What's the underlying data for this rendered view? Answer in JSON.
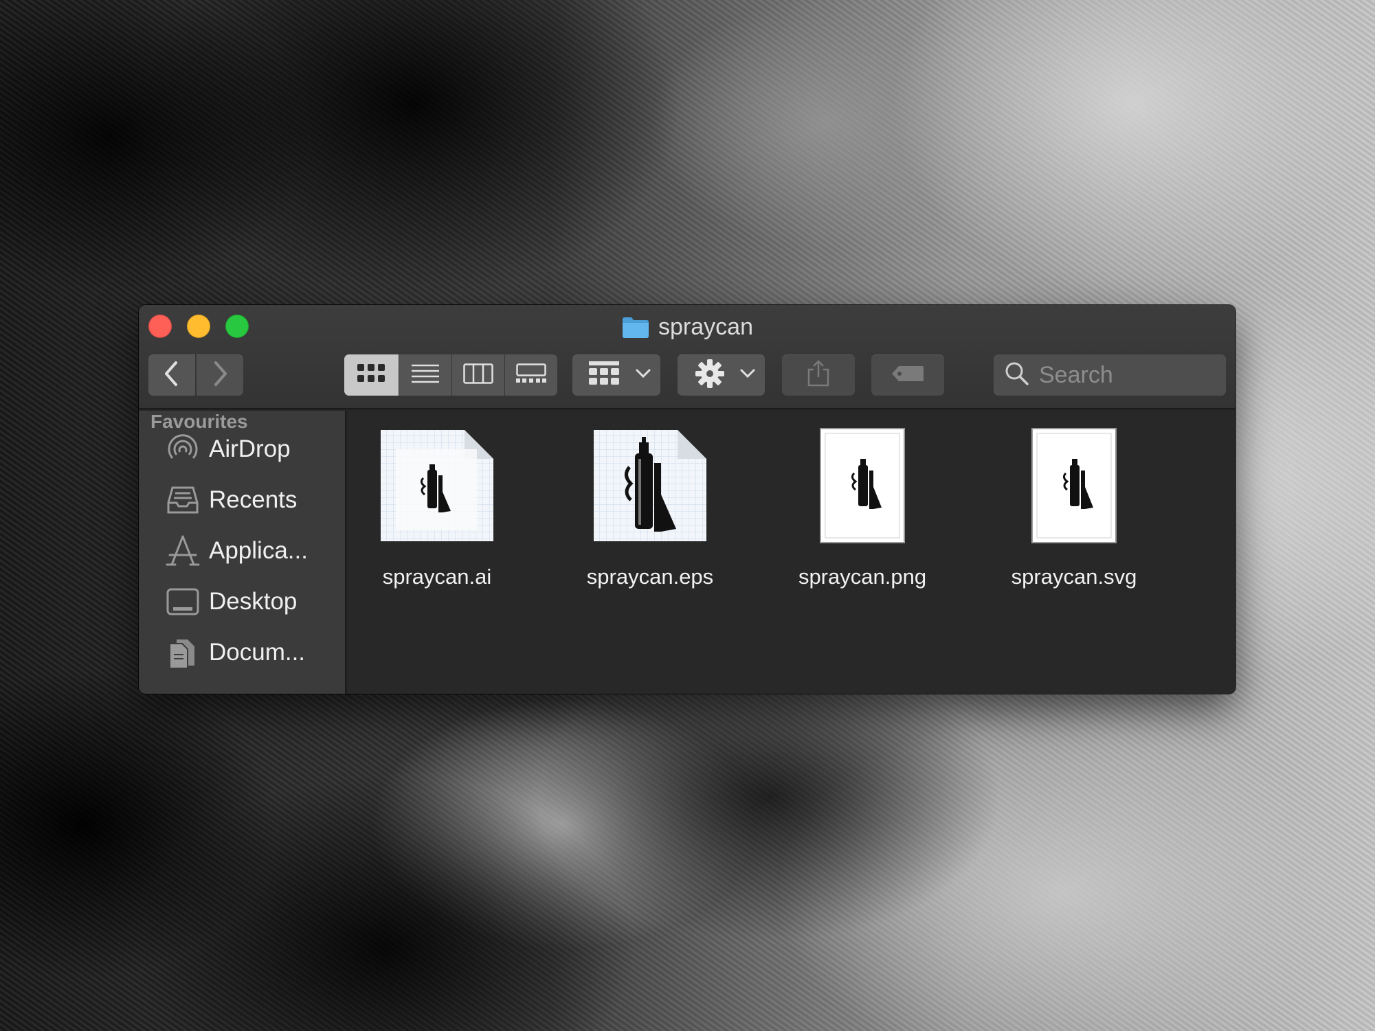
{
  "window": {
    "title": "spraycan"
  },
  "toolbar": {
    "back_icon": "chevron-left-icon",
    "forward_icon": "chevron-right-icon",
    "view_modes": [
      "icon-view",
      "list-view",
      "column-view",
      "gallery-view"
    ],
    "active_view": "icon-view",
    "group_icon": "group-by-icon",
    "action_icon": "gear-icon",
    "share_icon": "share-icon",
    "tag_icon": "tag-icon"
  },
  "search": {
    "placeholder": "Search"
  },
  "sidebar": {
    "heading": "Favourites",
    "items": [
      {
        "label": "AirDrop",
        "icon": "airdrop-icon"
      },
      {
        "label": "Recents",
        "icon": "recents-icon"
      },
      {
        "label": "Applica...",
        "icon": "applications-icon"
      },
      {
        "label": "Desktop",
        "icon": "desktop-icon"
      },
      {
        "label": "Docum...",
        "icon": "documents-icon"
      }
    ]
  },
  "files": [
    {
      "name": "spraycan.ai",
      "type": "ai"
    },
    {
      "name": "spraycan.eps",
      "type": "eps"
    },
    {
      "name": "spraycan.png",
      "type": "png"
    },
    {
      "name": "spraycan.svg",
      "type": "svg"
    }
  ],
  "colors": {
    "close": "#fe5f57",
    "minimize": "#febc2e",
    "maximize": "#28c840",
    "folder": "#5fb4ea"
  }
}
